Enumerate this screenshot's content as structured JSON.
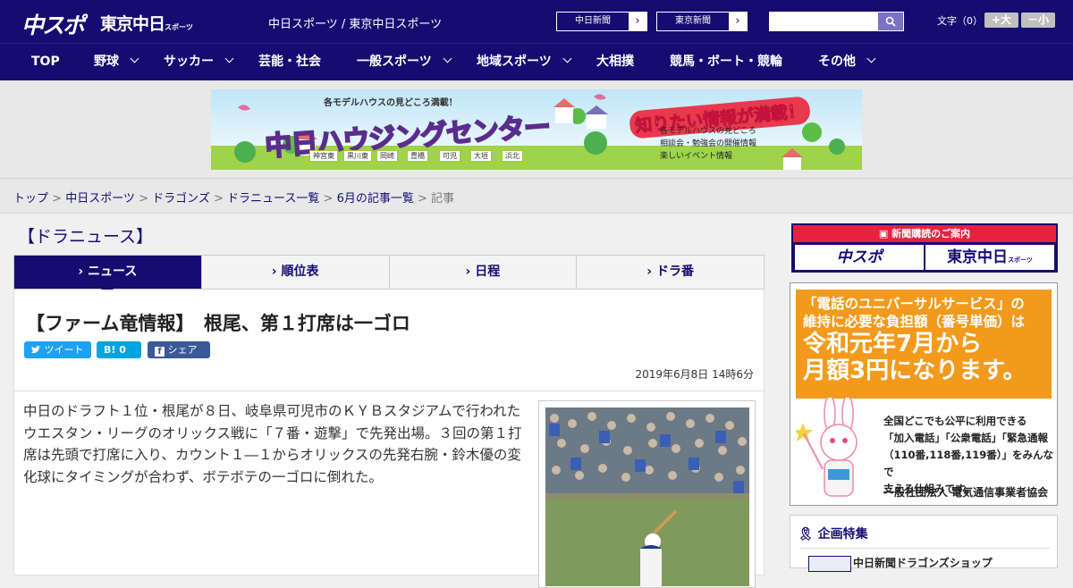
{
  "header": {
    "logo_chuspo": "中スポ",
    "logo_tokyo": "東京中日",
    "logo_tokyo_small": "スポーツ",
    "site_names": "中日スポーツ / 東京中日スポーツ",
    "btn_chunichi": "中日新聞",
    "btn_tokyo": "東京新聞",
    "arrow": "›",
    "search_placeholder": "",
    "font_label": "文字（0）",
    "font_larger": "+大",
    "font_smaller": "－小"
  },
  "nav": [
    "TOP",
    "野球",
    "サッカー",
    "芸能・社会",
    "一般スポーツ",
    "地域スポーツ",
    "大相撲",
    "競馬・ボート・競輪",
    "その他"
  ],
  "banner": {
    "top_text": "各モデルハウスの見どころ満載！",
    "main_text": "中日ハウジングセンター",
    "right_badge": "知りたい情報が満載！",
    "list": [
      "各モデルハウスの見どころ",
      "相談会・勉強会の開催情報",
      "楽しいイベント情報"
    ],
    "cities": [
      "神宮東",
      "黒川東",
      "岡崎",
      "豊橋",
      "可児",
      "大垣",
      "浜北"
    ]
  },
  "breadcrumbs": {
    "items": [
      "トップ",
      "中日スポーツ",
      "ドラゴンズ",
      "ドラニュース一覧",
      "6月の記事一覧"
    ],
    "current": "記事",
    "sep": " > "
  },
  "section_heading": "【ドラニュース】",
  "tabs": [
    {
      "label": "ニュース",
      "active": true
    },
    {
      "label": "順位表",
      "active": false
    },
    {
      "label": "日程",
      "active": false
    },
    {
      "label": "ドラ番",
      "active": false
    }
  ],
  "article": {
    "title": "【ファーム竜情報】　根尾、第１打席は一ゴロ",
    "share": {
      "tweet": "ツイート",
      "hatena": "B! 0",
      "facebook": "シェア 0"
    },
    "date": "2019年6月8日 14時6分",
    "body": "中日のドラフト１位・根尾が８日、岐阜県可児市のＫＹＢスタジアムで行われたウエスタン・リーグのオリックス戦に「７番・遊撃」で先発出場。３回の第１打席は先頭で打席に入り、カウント１―１からオリックスの先発右腕・鈴木優の変化球にタイミングが合わず、ボテボテの一ゴロに倒れた。"
  },
  "sidebar": {
    "subscribe_head": "新聞購読のご案内",
    "subscribe_logo1": "中スポ",
    "subscribe_logo2": "東京中日",
    "subscribe_logo2_small": "スポーツ",
    "ad_line1": "「電話のユニバーサルサービス」の",
    "ad_line2": "維持に必要な負担額（番号単価）は",
    "ad_line3": "令和元年7月から",
    "ad_line4": "月額3円になります。",
    "ad_body": [
      "全国どこでも公平に利用できる",
      "「加入電話」「公衆電話」「緊急通報",
      "（110番,118番,119番）」をみんなで",
      "支える仕組みです。"
    ],
    "ad_foot": "一般社団法人 電気通信事業者協会",
    "kikaku_heading": "企画特集",
    "kikaku_item": "中日新聞ドラゴンズショップ"
  },
  "colors": {
    "brand": "#150c72",
    "accent_red": "#e8213f",
    "ad_orange": "#f39a1c",
    "twitter": "#1da1f2",
    "hatena": "#00a4de",
    "facebook": "#3b5998"
  }
}
